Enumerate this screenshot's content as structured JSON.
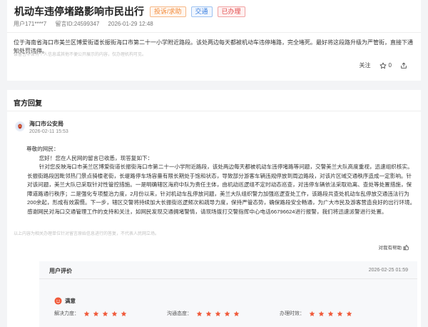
{
  "post": {
    "title": "机动车违停堵路影响市民出行",
    "tags": {
      "category": "投诉/求助",
      "field": "交通",
      "status": "已办理"
    },
    "user": "用户171****7",
    "message_id": "留言ID:24599347",
    "time": "2026-01-29 12:48",
    "content": "位于海南省海口市美兰区博爱街道长振街海口市第二十一小学附近路段。该处两边每天都被机动车违停堵路，完全堵死。最好将这段路升级为严管街，直接下通知处罚违停。",
    "disclaimer": "该留言中含有个人信息或其他不便公开展示的内容，仅办理机构可见。",
    "follow_label": "关注",
    "like_count": "0"
  },
  "reply": {
    "section_title": "官方回复",
    "org_name": "海口市公安局",
    "org_time": "2026-02-11 15:53",
    "greeting": "尊敬的网民：",
    "intro": "您好！您在人民网的留言已收悉，现答复如下：",
    "body": "针对您反映海口市美兰区博爱街道长振街海口市第二十一小学附近路段，该处两边每天都被机动车违停堵路等问题，交警美兰大队高度重视，迅速组织核实。长振街路段因毗邻热门景点骑楼老街，长堤路停车场容量有限长期处于饱和状态，导致部分游客车辆违规停放到周边路段，对该片区域交通秩序造成一定影响。针对该问题，美兰大队已采取针对性管控措施。一是明确辖区海府中队为责任主体，由机动巡逻组不定时动态巡查，对违停车辆依法采取劝离、查处等处置措施，保障道路通行秩序；二是强化专项整治力度，2月份以来，针对机动车乱停放问题，美兰大队组织警力加强巡逻查处工作，该路段共查处机动车乱停放交通违法行为200余起，形成有效震慑。下一步，辖区交警将持续加大长振街巡逻频次和疏导力度，保持严管态势，确保路段安全畅通，为广大市民及游客营造良好的出行环境。感谢网民对海口交通管理工作的支持和关注，如网民发现交通拥堵警情，请现场拨打交警指挥中心电话66796624进行报警，我们将迅速派警进行处置。",
    "disclaimer": "以上内容为相关办理单位针对留言原始信息进行的答复，不代表人民网立场。",
    "helpful_label": "对我有帮助"
  },
  "evaluation": {
    "title": "用户评价",
    "time": "2026-02-25 01:59",
    "satisfaction": "满意",
    "ratings": [
      {
        "label": "解决力度：",
        "stars": 5
      },
      {
        "label": "沟通态度：",
        "stars": 5
      },
      {
        "label": "办理时效：",
        "stars": 5
      }
    ]
  },
  "colors": {
    "star": "#f05a3a",
    "accent_blue": "#3a7fde"
  }
}
